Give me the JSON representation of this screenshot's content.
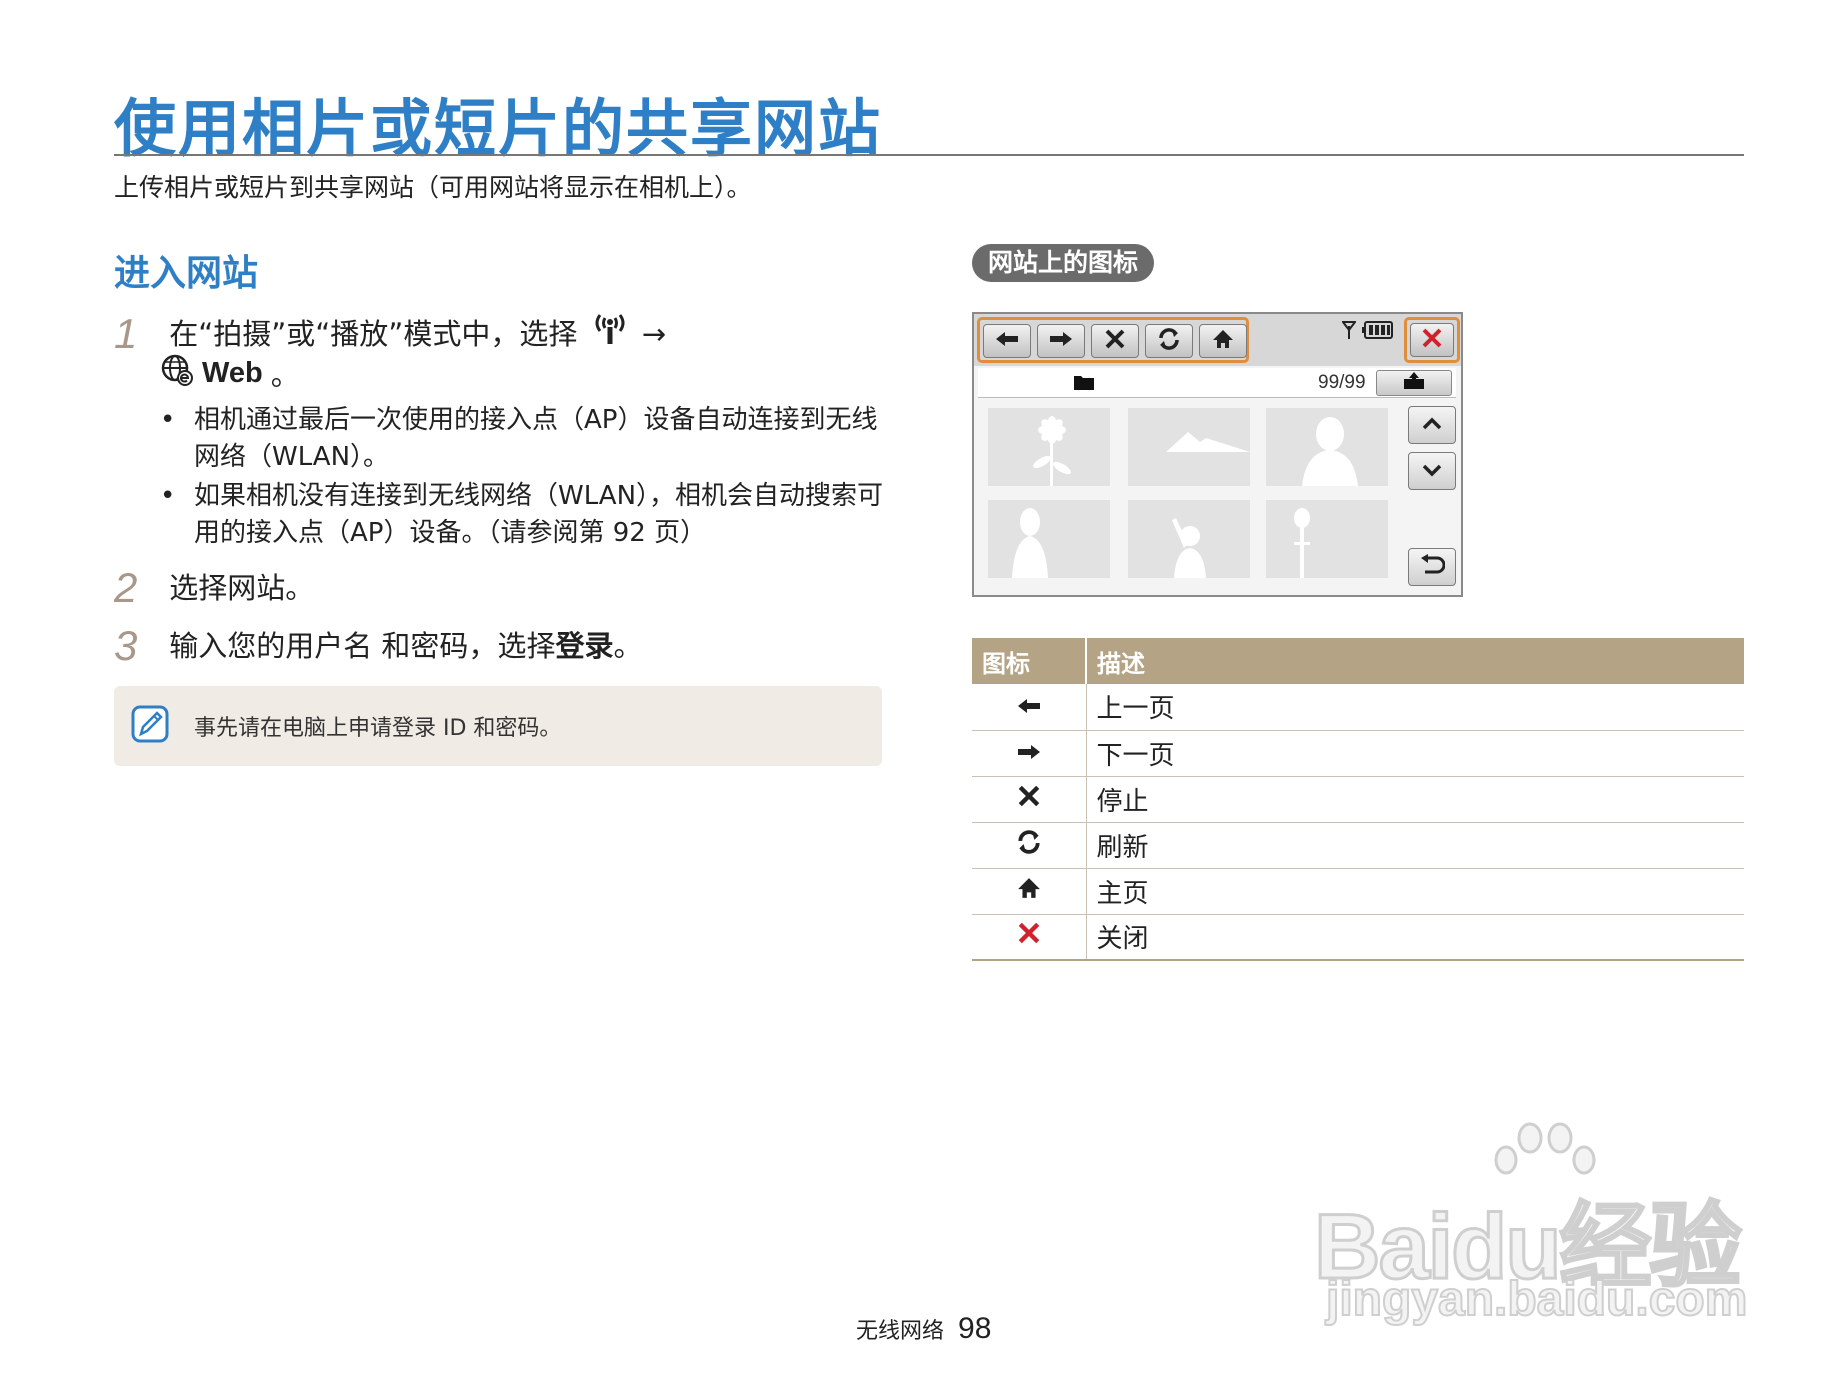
{
  "header": {
    "title": "使用相片或短片的共享网站",
    "subtitle": "上传相片或短片到共享网站（可用网站将显示在相机上）。"
  },
  "section": {
    "heading": "进入网站",
    "steps": [
      {
        "num": "1",
        "text_part1": "在“拍摄”或“播放”模式中，选择",
        "arrow": "→",
        "web_label": "Web",
        "text_end": "。",
        "bullets": [
          "相机通过最后一次使用的接入点（AP）设备自动连接到无线网络（WLAN）。",
          "如果相机没有连接到无线网络（WLAN），相机会自动搜索可用的接入点（AP）设备。（请参阅第 92 页）"
        ]
      },
      {
        "num": "2",
        "text": "选择网站。"
      },
      {
        "num": "3",
        "text_prefix": "输入您的用户名 和密码，选择",
        "bold_word": "登录",
        "text_suffix": "。"
      }
    ],
    "note": "事先请在电脑上申请登录 ID 和密码。"
  },
  "icons_panel": {
    "pill_label": "网站上的图标",
    "screen": {
      "page_count": "99/99",
      "nav_icons": [
        "arrow-left-icon",
        "arrow-right-icon",
        "stop-x-icon",
        "refresh-icon",
        "home-icon"
      ]
    }
  },
  "icon_table": {
    "headers": [
      "图标",
      "描述"
    ],
    "rows": [
      {
        "icon": "arrow-left-icon",
        "desc": "上一页"
      },
      {
        "icon": "arrow-right-icon",
        "desc": "下一页"
      },
      {
        "icon": "stop-x-icon",
        "desc": "停止"
      },
      {
        "icon": "refresh-icon",
        "desc": "刷新"
      },
      {
        "icon": "home-icon",
        "desc": "主页"
      },
      {
        "icon": "close-red-x-icon",
        "desc": "关闭"
      }
    ]
  },
  "footer": {
    "section": "无线网络",
    "page": "98"
  },
  "watermark": {
    "main": "Baidu经验",
    "sub": "jingyan.baidu.com"
  },
  "colors": {
    "title_blue": "#2e7fc5",
    "table_header": "#b5a385",
    "highlight_orange": "#e08d3c",
    "close_red": "#d0222a"
  }
}
